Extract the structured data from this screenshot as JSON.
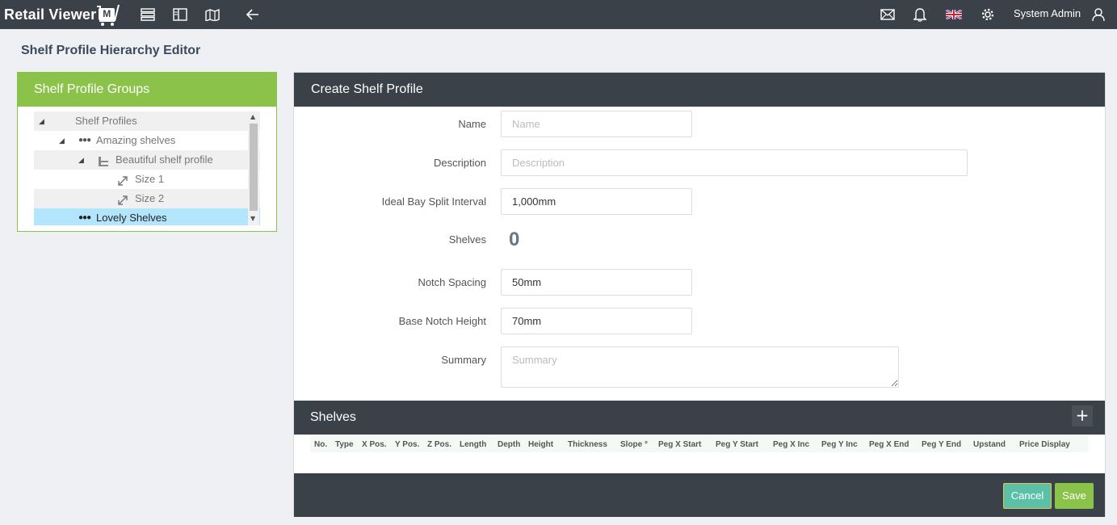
{
  "app": {
    "logo_text": "Retail Viewer",
    "logo_badge": "M",
    "user_name": "System Admin"
  },
  "page": {
    "title": "Shelf Profile Hierarchy Editor"
  },
  "left_panel": {
    "title": "Shelf Profile Groups",
    "tree": [
      {
        "label": "Shelf Profiles",
        "level": 0,
        "icon": "none",
        "expanded": true
      },
      {
        "label": "Amazing shelves",
        "level": 1,
        "icon": "dots-icon",
        "expanded": true
      },
      {
        "label": "Beautiful shelf profile",
        "level": 2,
        "icon": "shelf-profile-icon",
        "expanded": true
      },
      {
        "label": "Size 1",
        "level": 3,
        "icon": "resize-icon"
      },
      {
        "label": "Size 2",
        "level": 3,
        "icon": "resize-icon"
      },
      {
        "label": "Lovely Shelves",
        "level": 1,
        "icon": "dots-icon",
        "selected": true
      }
    ]
  },
  "form": {
    "title": "Create Shelf Profile",
    "name_label": "Name",
    "name_placeholder": "Name",
    "name_value": "",
    "description_label": "Description",
    "description_placeholder": "Description",
    "description_value": "",
    "bay_split_label": "Ideal Bay Split Interval",
    "bay_split_value": "1,000mm",
    "shelves_label": "Shelves",
    "shelves_count": "0",
    "notch_spacing_label": "Notch Spacing",
    "notch_spacing_value": "50mm",
    "base_notch_label": "Base Notch Height",
    "base_notch_value": "70mm",
    "summary_label": "Summary",
    "summary_placeholder": "Summary",
    "summary_value": ""
  },
  "shelves": {
    "title": "Shelves",
    "add_label": "+",
    "columns": [
      "No.",
      "Type",
      "X Pos.",
      "Y Pos.",
      "Z Pos.",
      "Length",
      "Depth",
      "Height",
      "Thickness",
      "Slope °",
      "Peg X Start",
      "Peg Y Start",
      "Peg X Inc",
      "Peg Y Inc",
      "Peg X End",
      "Peg Y End",
      "Upstand",
      "Price Display"
    ]
  },
  "footer": {
    "cancel_label": "Cancel",
    "save_label": "Save"
  },
  "colors": {
    "topbar": "#3b4149",
    "accent_green": "#8bc34a",
    "cancel_teal": "#5bc0a8",
    "selected_row": "#b3e5fc"
  }
}
